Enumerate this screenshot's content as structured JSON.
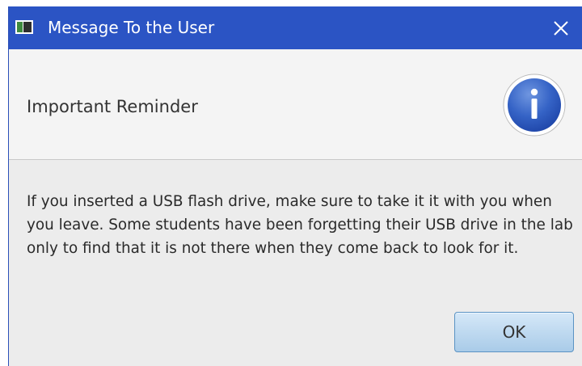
{
  "window": {
    "title": "Message To the User",
    "icon": "app-window-icon",
    "close_icon": "close-icon",
    "titlebar_color": "#2b54c4"
  },
  "header": {
    "text": "Important Reminder",
    "icon": "info-icon",
    "icon_glyph": "i",
    "icon_color": "#2f5fc4"
  },
  "content": {
    "message": "If you inserted a USB flash drive, make sure to take it it with you when you leave.  Some students have been forgetting their USB drive in the lab only to find that it is not there when they come back to look for it."
  },
  "buttons": {
    "ok_label": "OK"
  }
}
